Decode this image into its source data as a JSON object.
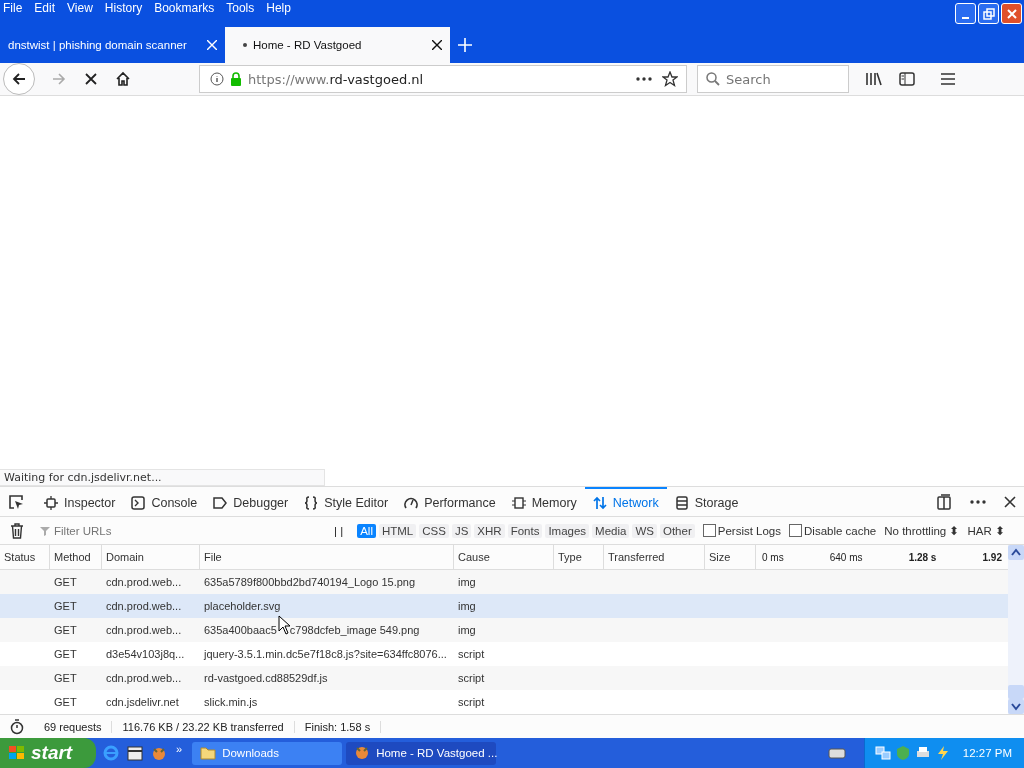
{
  "menu_bar": [
    "File",
    "Edit",
    "View",
    "History",
    "Bookmarks",
    "Tools",
    "Help"
  ],
  "tabs": [
    {
      "title": "dnstwist | phishing domain scanner",
      "selected": false,
      "loading": false
    },
    {
      "title": "Home - RD Vastgoed",
      "selected": true,
      "loading": true
    }
  ],
  "address_bar": {
    "url_host_prefix": "https://www.",
    "url_domain": "rd-vastgoed.nl",
    "secure": true
  },
  "search": {
    "placeholder": "Search"
  },
  "status_text": "Waiting for cdn.jsdelivr.net...",
  "devtools_tabs": [
    {
      "label": "Inspector",
      "selected": false
    },
    {
      "label": "Console",
      "selected": false
    },
    {
      "label": "Debugger",
      "selected": false
    },
    {
      "label": "Style Editor",
      "selected": false
    },
    {
      "label": "Performance",
      "selected": false
    },
    {
      "label": "Memory",
      "selected": false
    },
    {
      "label": "Network",
      "selected": true
    },
    {
      "label": "Storage",
      "selected": false
    }
  ],
  "filter": {
    "placeholder": "Filter URLs",
    "pause": "| |"
  },
  "type_filters": [
    {
      "label": "All",
      "selected": true
    },
    {
      "label": "HTML",
      "selected": false
    },
    {
      "label": "CSS",
      "selected": false
    },
    {
      "label": "JS",
      "selected": false
    },
    {
      "label": "XHR",
      "selected": false
    },
    {
      "label": "Fonts",
      "selected": false
    },
    {
      "label": "Images",
      "selected": false
    },
    {
      "label": "Media",
      "selected": false
    },
    {
      "label": "WS",
      "selected": false
    },
    {
      "label": "Other",
      "selected": false
    }
  ],
  "options": [
    {
      "label": "Persist Logs",
      "checked": false
    },
    {
      "label": "Disable cache",
      "checked": false
    }
  ],
  "throttling": "No throttling ⬍",
  "har": "HAR ⬍",
  "columns": [
    "Status",
    "Method",
    "Domain",
    "File",
    "Cause",
    "Type",
    "Transferred",
    "Size"
  ],
  "timeline_ticks": [
    {
      "label": "0 ms",
      "bold": false
    },
    {
      "label": "640 ms",
      "bold": false
    },
    {
      "label": "1.28 s",
      "bold": true
    },
    {
      "label": "1.92",
      "bold": true
    }
  ],
  "rows": [
    {
      "method": "GET",
      "domain": "cdn.prod.web...",
      "file": "635a5789f800bbd2bd740194_Logo 15.png",
      "cause": "img",
      "selected": false
    },
    {
      "method": "GET",
      "domain": "cdn.prod.web...",
      "file": "placeholder.svg",
      "cause": "img",
      "selected": true
    },
    {
      "method": "GET",
      "domain": "cdn.prod.web...",
      "file": "635a400baac5",
      "file_after_cursor": "c798dcfeb_image 549.png",
      "cause": "img",
      "selected": false
    },
    {
      "method": "GET",
      "domain": "d3e54v103j8q...",
      "file": "jquery-3.5.1.min.dc5e7f18c8.js?site=634ffc8076...",
      "cause": "script",
      "selected": false
    },
    {
      "method": "GET",
      "domain": "cdn.prod.web...",
      "file": "rd-vastgoed.cd88529df.js",
      "cause": "script",
      "selected": false
    },
    {
      "method": "GET",
      "domain": "cdn.jsdelivr.net",
      "file": "slick.min.js",
      "cause": "script",
      "selected": false
    }
  ],
  "summary": {
    "requests": "69 requests",
    "size": "116.76 KB / 23.22 KB transferred",
    "finish": "Finish: 1.58 s"
  },
  "taskbar": {
    "start": "start",
    "tasks": [
      {
        "label": "Downloads",
        "selected": false
      },
      {
        "label": "Home - RD Vastgoed ...",
        "selected": true
      }
    ],
    "more": "»",
    "clock": "12:27 PM"
  }
}
